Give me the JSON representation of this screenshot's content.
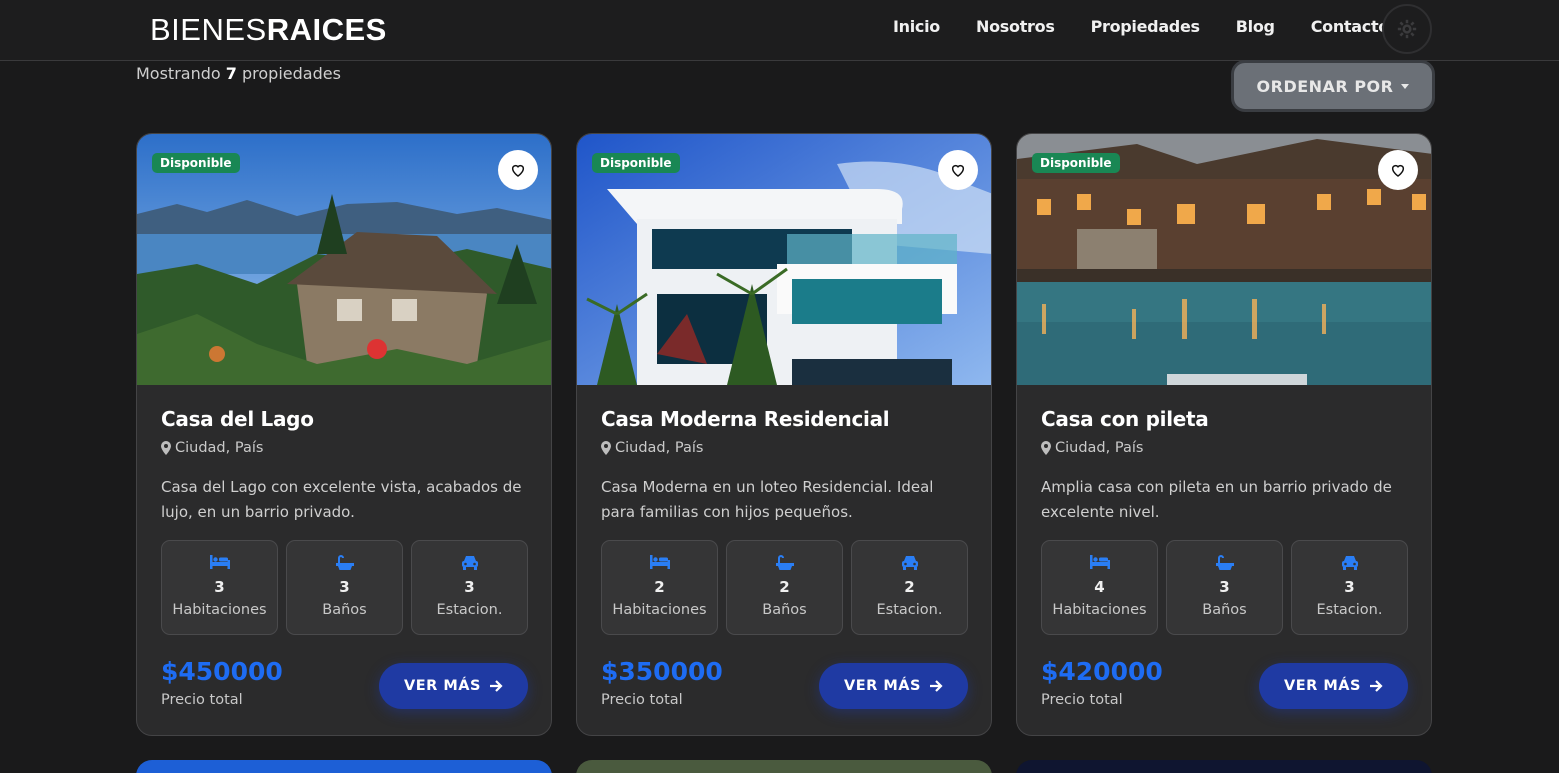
{
  "header": {
    "logo_thin": "BIENES",
    "logo_bold": "RAICES",
    "nav": [
      "Inicio",
      "Nosotros",
      "Propiedades",
      "Blog",
      "Contacto"
    ],
    "theme_icon": "gear-icon"
  },
  "listing": {
    "count_prefix": "Mostrando",
    "count": "7",
    "count_suffix": "propiedades",
    "sort_label": "ORDENAR POR"
  },
  "cards": [
    {
      "badge": "Disponible",
      "title": "Casa del Lago",
      "location": "Ciudad, País",
      "description": "Casa del Lago con excelente vista, acabados de lujo, en un barrio privado.",
      "features": [
        {
          "icon": "bed-icon",
          "value": "3",
          "label": "Habitaciones"
        },
        {
          "icon": "bath-icon",
          "value": "3",
          "label": "Baños"
        },
        {
          "icon": "car-icon",
          "value": "3",
          "label": "Estacion."
        }
      ],
      "price": "$450000",
      "price_label": "Precio total",
      "button": "VER MÁS"
    },
    {
      "badge": "Disponible",
      "title": "Casa Moderna Residencial",
      "location": "Ciudad, País",
      "description": "Casa Moderna en un loteo Residencial. Ideal para familias con hijos pequeños.",
      "features": [
        {
          "icon": "bed-icon",
          "value": "2",
          "label": "Habitaciones"
        },
        {
          "icon": "bath-icon",
          "value": "2",
          "label": "Baños"
        },
        {
          "icon": "car-icon",
          "value": "2",
          "label": "Estacion."
        }
      ],
      "price": "$350000",
      "price_label": "Precio total",
      "button": "VER MÁS"
    },
    {
      "badge": "Disponible",
      "title": "Casa con pileta",
      "location": "Ciudad, País",
      "description": "Amplia casa con pileta en un barrio privado de excelente nivel.",
      "features": [
        {
          "icon": "bed-icon",
          "value": "4",
          "label": "Habitaciones"
        },
        {
          "icon": "bath-icon",
          "value": "3",
          "label": "Baños"
        },
        {
          "icon": "car-icon",
          "value": "3",
          "label": "Estacion."
        }
      ],
      "price": "$420000",
      "price_label": "Precio total",
      "button": "VER MÁS"
    }
  ],
  "colors": {
    "accent": "#1e6cf3",
    "button": "#1f3aa3",
    "badge": "#198754",
    "background": "#1a1a1b",
    "card": "#2b2b2c"
  }
}
